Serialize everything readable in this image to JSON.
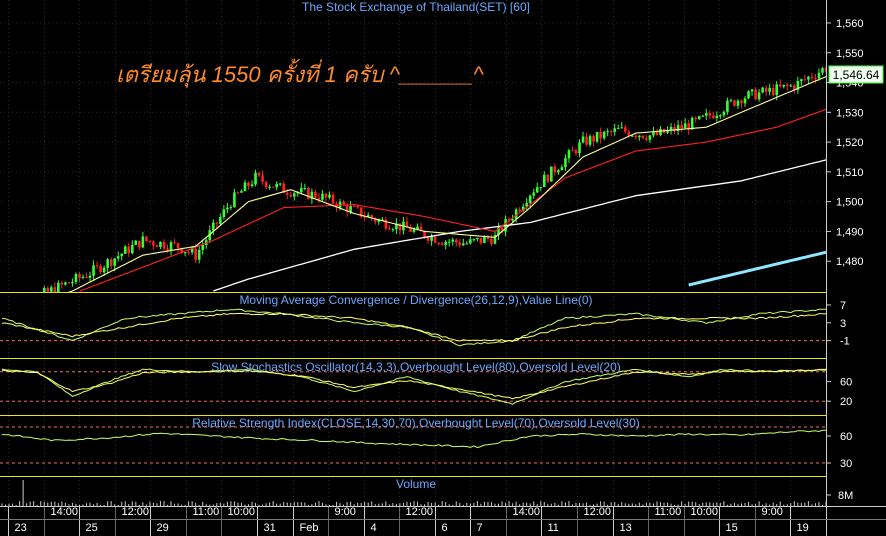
{
  "chart_data": {
    "type": "candlestick",
    "title": "The Stock Exchange of Thailand(SET) [60]",
    "annotation": "เตรียมลุ้น 1550 ครั้งที่ 1 ครับ ^______^",
    "last_price_label": "1,546.64",
    "colors": {
      "up": "#33ff33",
      "down": "#ff2020",
      "panel_border": "#e8e800",
      "label": "#6aa8ff",
      "axis_text": "#ffffff",
      "annotation": "#ff8a2a",
      "ma_short": "#ffff99",
      "ma_mid": "#ff2020",
      "ma_long": "#ffffff",
      "ma_200": "#8ee8ff",
      "osc_line": "#ccff66",
      "osc_signal": "#ffff66",
      "level_line": "#ff6666"
    },
    "x_labels": [
      "23",
      "14:00",
      "25",
      "12:00",
      "29",
      "11:00",
      "10:00",
      "31",
      "Feb",
      "9:00",
      "4",
      "12:00",
      "6",
      "7",
      "14:00",
      "11",
      "12:00",
      "13",
      "11:00",
      "10:00",
      "15",
      "9:00",
      "19"
    ],
    "panels": [
      {
        "id": "price",
        "y_ticks": [
          "1,560",
          "1,550",
          "1,540",
          "1,530",
          "1,520",
          "1,510",
          "1,500",
          "1,490",
          "1,480"
        ],
        "ylim": [
          1472,
          1561
        ],
        "close_path": [
          [
            0,
            1465
          ],
          [
            10,
            1468
          ],
          [
            25,
            1476
          ],
          [
            40,
            1487
          ],
          [
            50,
            1485
          ],
          [
            55,
            1482
          ],
          [
            65,
            1500
          ],
          [
            72,
            1508
          ],
          [
            80,
            1504
          ],
          [
            90,
            1502
          ],
          [
            98,
            1498
          ],
          [
            106,
            1494
          ],
          [
            115,
            1491
          ],
          [
            125,
            1487
          ],
          [
            132,
            1486
          ],
          [
            140,
            1488
          ],
          [
            150,
            1503
          ],
          [
            165,
            1520
          ],
          [
            175,
            1524
          ],
          [
            185,
            1522
          ],
          [
            198,
            1527
          ],
          [
            210,
            1535
          ],
          [
            225,
            1539
          ],
          [
            234,
            1545
          ]
        ],
        "ma_short_path": [
          [
            0,
            1463
          ],
          [
            20,
            1470
          ],
          [
            40,
            1482
          ],
          [
            55,
            1485
          ],
          [
            70,
            1500
          ],
          [
            82,
            1504
          ],
          [
            100,
            1496
          ],
          [
            120,
            1490
          ],
          [
            140,
            1488
          ],
          [
            150,
            1498
          ],
          [
            165,
            1515
          ],
          [
            180,
            1523
          ],
          [
            200,
            1525
          ],
          [
            220,
            1535
          ],
          [
            234,
            1542
          ]
        ],
        "ma_mid_path": [
          [
            0,
            1460
          ],
          [
            40,
            1478
          ],
          [
            60,
            1487
          ],
          [
            80,
            1498
          ],
          [
            100,
            1499
          ],
          [
            120,
            1495
          ],
          [
            140,
            1490
          ],
          [
            160,
            1508
          ],
          [
            180,
            1517
          ],
          [
            200,
            1520
          ],
          [
            220,
            1525
          ],
          [
            234,
            1531
          ]
        ],
        "ma_long_path": [
          [
            0,
            1450
          ],
          [
            40,
            1462
          ],
          [
            70,
            1474
          ],
          [
            100,
            1484
          ],
          [
            130,
            1490
          ],
          [
            150,
            1493
          ],
          [
            180,
            1502
          ],
          [
            210,
            1507
          ],
          [
            234,
            1514
          ]
        ],
        "ma_200_path": [
          [
            195,
            1472
          ],
          [
            234,
            1483
          ]
        ]
      },
      {
        "id": "macd",
        "label": "Moving Average Convergence / Divergence(26,12,9),Value Line(0)",
        "y_ticks": [
          "7",
          "3",
          "-1"
        ],
        "ylim": [
          -4,
          9
        ],
        "level": -1,
        "macd_path": [
          [
            0,
            4
          ],
          [
            20,
            -1
          ],
          [
            35,
            4
          ],
          [
            50,
            5
          ],
          [
            65,
            6
          ],
          [
            80,
            5
          ],
          [
            100,
            3
          ],
          [
            115,
            2
          ],
          [
            130,
            -2
          ],
          [
            145,
            -1
          ],
          [
            160,
            4
          ],
          [
            180,
            5
          ],
          [
            200,
            3
          ],
          [
            215,
            5
          ],
          [
            234,
            6
          ]
        ],
        "signal_path": [
          [
            0,
            3
          ],
          [
            20,
            0
          ],
          [
            35,
            2
          ],
          [
            50,
            4
          ],
          [
            65,
            5
          ],
          [
            80,
            5
          ],
          [
            100,
            4
          ],
          [
            115,
            2
          ],
          [
            130,
            -1
          ],
          [
            145,
            -1
          ],
          [
            160,
            2
          ],
          [
            180,
            4
          ],
          [
            200,
            4
          ],
          [
            215,
            4
          ],
          [
            234,
            5
          ]
        ]
      },
      {
        "id": "stoch",
        "label": "Slow Stochastics Oscillator(14,3,3),Overbought Level(80),Oversold Level(20)",
        "y_ticks": [
          "60",
          "20"
        ],
        "ylim": [
          0,
          100
        ],
        "levels": [
          80,
          20
        ],
        "k_path": [
          [
            0,
            85
          ],
          [
            10,
            80
          ],
          [
            20,
            30
          ],
          [
            30,
            60
          ],
          [
            40,
            85
          ],
          [
            55,
            80
          ],
          [
            70,
            85
          ],
          [
            85,
            70
          ],
          [
            100,
            40
          ],
          [
            115,
            70
          ],
          [
            130,
            40
          ],
          [
            145,
            15
          ],
          [
            160,
            60
          ],
          [
            180,
            85
          ],
          [
            195,
            70
          ],
          [
            205,
            85
          ],
          [
            220,
            80
          ],
          [
            234,
            85
          ]
        ],
        "d_path": [
          [
            0,
            82
          ],
          [
            10,
            78
          ],
          [
            20,
            40
          ],
          [
            30,
            55
          ],
          [
            40,
            78
          ],
          [
            55,
            80
          ],
          [
            70,
            82
          ],
          [
            85,
            72
          ],
          [
            100,
            48
          ],
          [
            115,
            62
          ],
          [
            130,
            45
          ],
          [
            145,
            25
          ],
          [
            160,
            50
          ],
          [
            180,
            80
          ],
          [
            195,
            75
          ],
          [
            205,
            80
          ],
          [
            220,
            82
          ],
          [
            234,
            84
          ]
        ]
      },
      {
        "id": "rsi",
        "label": "Relative Strength Index(CLOSE,14,30,70),Overbought Level(70),Oversold Level(30)",
        "y_ticks": [
          "60",
          "30"
        ],
        "ylim": [
          20,
          80
        ],
        "levels": [
          70,
          30
        ],
        "rsi_path": [
          [
            0,
            62
          ],
          [
            15,
            55
          ],
          [
            30,
            58
          ],
          [
            45,
            63
          ],
          [
            60,
            60
          ],
          [
            75,
            57
          ],
          [
            90,
            55
          ],
          [
            105,
            52
          ],
          [
            120,
            50
          ],
          [
            135,
            48
          ],
          [
            150,
            60
          ],
          [
            165,
            62
          ],
          [
            180,
            60
          ],
          [
            195,
            62
          ],
          [
            210,
            61
          ],
          [
            225,
            65
          ],
          [
            234,
            66
          ]
        ]
      },
      {
        "id": "volume",
        "label": "Volume",
        "y_ticks": [
          "8M"
        ]
      }
    ]
  }
}
